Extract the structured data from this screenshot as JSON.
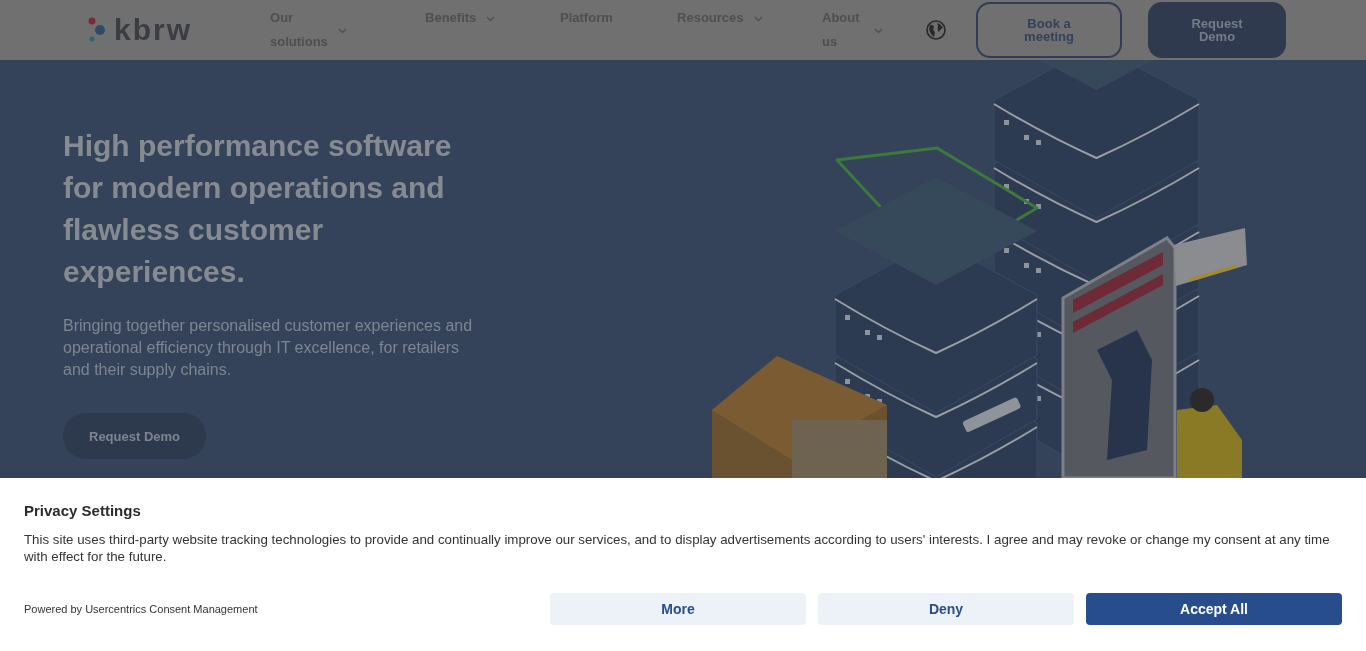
{
  "header": {
    "logo": "kbrw",
    "nav": [
      {
        "label": "Our solutions",
        "has_dropdown": true
      },
      {
        "label": "Benefits",
        "has_dropdown": true
      },
      {
        "label": "Platform",
        "has_dropdown": false
      },
      {
        "label": "Resources",
        "has_dropdown": true
      },
      {
        "label": "About us",
        "has_dropdown": true
      }
    ],
    "buttons": [
      {
        "label": "Book a meeting",
        "kind": "outline"
      },
      {
        "label": "Request Demo",
        "kind": "filled"
      }
    ]
  },
  "hero": {
    "heading": "High performance software for modern operations and flawless customer experiences.",
    "subtitle": "Bringing together personalised customer experiences and operational efficiency through IT excellence, for retailers and their supply chains.",
    "cta": "Request Demo"
  },
  "consent": {
    "title": "Privacy Settings",
    "text": "This site uses third-party website tracking technologies to provide and continually improve our services, and to display advertisements according to users' interests. I agree and may revoke or change my consent at any time with effect for the future.",
    "powered_by": "Powered by Usercentrics Consent Management",
    "buttons": [
      {
        "label": "More",
        "kind": "secondary"
      },
      {
        "label": "Deny",
        "kind": "secondary"
      },
      {
        "label": "Accept All",
        "kind": "primary"
      }
    ]
  }
}
